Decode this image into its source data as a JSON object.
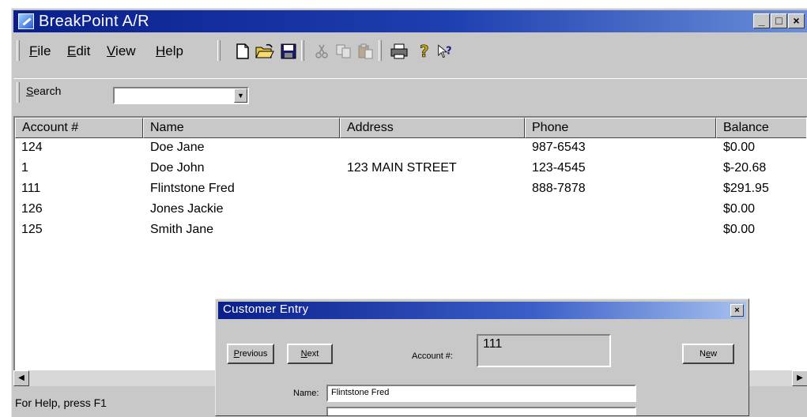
{
  "window": {
    "title": "BreakPoint A/R",
    "minimize_label": "_",
    "maximize_label": "□",
    "close_label": "×"
  },
  "menu": {
    "items": [
      {
        "label": "ile",
        "mnemonic": "F"
      },
      {
        "label": "dit",
        "mnemonic": "E"
      },
      {
        "label": "iew",
        "mnemonic": "V"
      },
      {
        "label": "elp",
        "mnemonic": "H"
      }
    ]
  },
  "toolbar": {
    "icons": [
      "new-file-icon",
      "open-folder-icon",
      "save-disk-icon",
      "cut-scissors-icon",
      "copy-icon",
      "paste-icon",
      "print-icon",
      "help-icon",
      "context-help-icon"
    ]
  },
  "search": {
    "label_mnemonic": "S",
    "label_rest": "earch",
    "value": "",
    "dropdown_glyph": "▼"
  },
  "table": {
    "columns": [
      "Account #",
      "Name",
      "Address",
      "Phone",
      "Balance"
    ],
    "rows": [
      [
        "124",
        "Doe Jane",
        "",
        "987-6543",
        "$0.00"
      ],
      [
        "1",
        "Doe John",
        "123 MAIN STREET",
        "123-4545",
        "$-20.68"
      ],
      [
        "111",
        "Flintstone Fred",
        "",
        "888-7878",
        "$291.95"
      ],
      [
        "126",
        "Jones Jackie",
        "",
        "",
        "$0.00"
      ],
      [
        "125",
        "Smith Jane",
        "",
        "",
        "$0.00"
      ]
    ]
  },
  "scrollbar": {
    "left_glyph": "◀",
    "right_glyph": "▶"
  },
  "status": {
    "text": "For Help, press F1"
  },
  "dialog": {
    "title": "Customer Entry",
    "close_label": "×",
    "previous_label": "Previous",
    "next_label": "Next",
    "new_label": "New",
    "account_label": "Account #:",
    "account_value": "111",
    "name_label": "Name:",
    "name_value": "Flintstone Fred"
  },
  "colors": {
    "titlebar_start": "#0a1f8c",
    "titlebar_end": "#6a8fd8",
    "face": "#c8c8c8"
  }
}
